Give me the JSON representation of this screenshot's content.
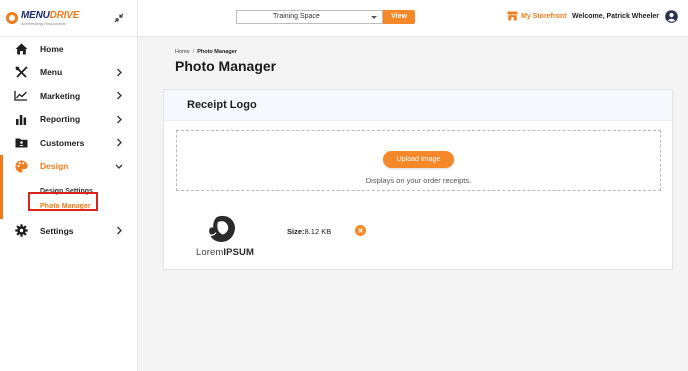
{
  "brand": {
    "name_part1": "MENU",
    "name_part2": "DRIVE",
    "tagline": "Accelerating Restaurants",
    "accent_color": "#f07c1c"
  },
  "sidebar": {
    "items": [
      {
        "label": "Home",
        "icon": "home-icon",
        "has_chevron": false
      },
      {
        "label": "Menu",
        "icon": "utensils-icon",
        "has_chevron": true
      },
      {
        "label": "Marketing",
        "icon": "trend-chart-icon",
        "has_chevron": true
      },
      {
        "label": "Reporting",
        "icon": "bar-chart-icon",
        "has_chevron": true
      },
      {
        "label": "Customers",
        "icon": "customer-card-icon",
        "has_chevron": true
      },
      {
        "label": "Design",
        "icon": "palette-icon",
        "has_chevron": true,
        "expanded": true
      },
      {
        "label": "Settings",
        "icon": "gear-icon",
        "has_chevron": true
      }
    ],
    "design_sub": [
      {
        "label": "Design Settings"
      },
      {
        "label": "Photo Manager",
        "current": true
      }
    ]
  },
  "topbar": {
    "space_value": "Training Space",
    "view_label": "View",
    "storefront_label": "My Storefront",
    "welcome": "Welcome, Patrick Wheeler"
  },
  "breadcrumb": {
    "home": "Home",
    "separator": "/",
    "current": "Photo Manager"
  },
  "page": {
    "title": "Photo Manager"
  },
  "card": {
    "title": "Receipt Logo",
    "upload_label": "Upload Image",
    "hint": "Displays on your order receipts.",
    "logo_text_light": "Lorem",
    "logo_text_bold": "IPSUM",
    "size_key": "Size:",
    "size_value": "8.12 KB"
  }
}
